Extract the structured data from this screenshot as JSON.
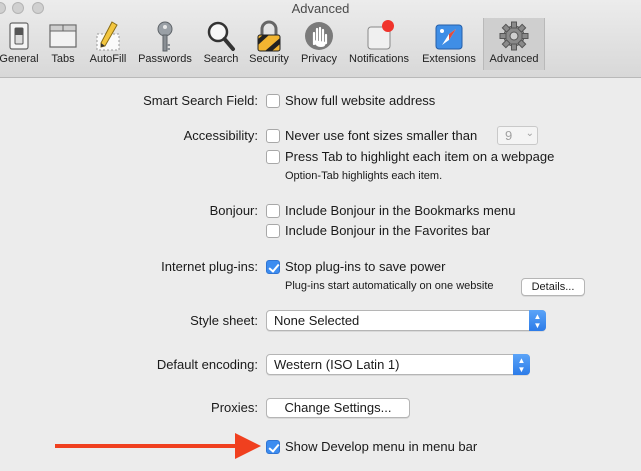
{
  "window": {
    "title": "Advanced"
  },
  "toolbar": {
    "items": [
      {
        "label": "General",
        "icon": "general-switch-icon"
      },
      {
        "label": "Tabs",
        "icon": "tabs-icon"
      },
      {
        "label": "AutoFill",
        "icon": "autofill-pencil-icon"
      },
      {
        "label": "Passwords",
        "icon": "key-icon"
      },
      {
        "label": "Search",
        "icon": "magnifier-icon"
      },
      {
        "label": "Security",
        "icon": "padlock-icon"
      },
      {
        "label": "Privacy",
        "icon": "hand-icon"
      },
      {
        "label": "Notifications",
        "icon": "notification-badge-icon"
      },
      {
        "label": "Extensions",
        "icon": "puzzle-compass-icon"
      },
      {
        "label": "Advanced",
        "icon": "gear-icon"
      }
    ],
    "selected": "Advanced"
  },
  "prefs": {
    "smart_search": {
      "label": "Smart Search Field:",
      "option": "Show full website address",
      "checked": false
    },
    "accessibility": {
      "label": "Accessibility:",
      "font_option": "Never use font sizes smaller than",
      "font_size": "9",
      "font_checked": false,
      "tab_option": "Press Tab to highlight each item on a webpage",
      "tab_checked": false,
      "tab_hint": "Option-Tab highlights each item."
    },
    "bonjour": {
      "label": "Bonjour:",
      "bookmarks_option": "Include Bonjour in the Bookmarks menu",
      "favorites_option": "Include Bonjour in the Favorites bar"
    },
    "plugins": {
      "label": "Internet plug-ins:",
      "option": "Stop plug-ins to save power",
      "checked": true,
      "hint": "Plug-ins start automatically on one website",
      "details_button": "Details..."
    },
    "style_sheet": {
      "label": "Style sheet:",
      "value": "None Selected"
    },
    "encoding": {
      "label": "Default encoding:",
      "value": "Western (ISO Latin 1)"
    },
    "proxies": {
      "label": "Proxies:",
      "button": "Change Settings..."
    },
    "develop": {
      "option": "Show Develop menu in menu bar",
      "checked": true
    }
  },
  "colors": {
    "accent": "#3c8cf0",
    "arrow": "#f0401f"
  }
}
